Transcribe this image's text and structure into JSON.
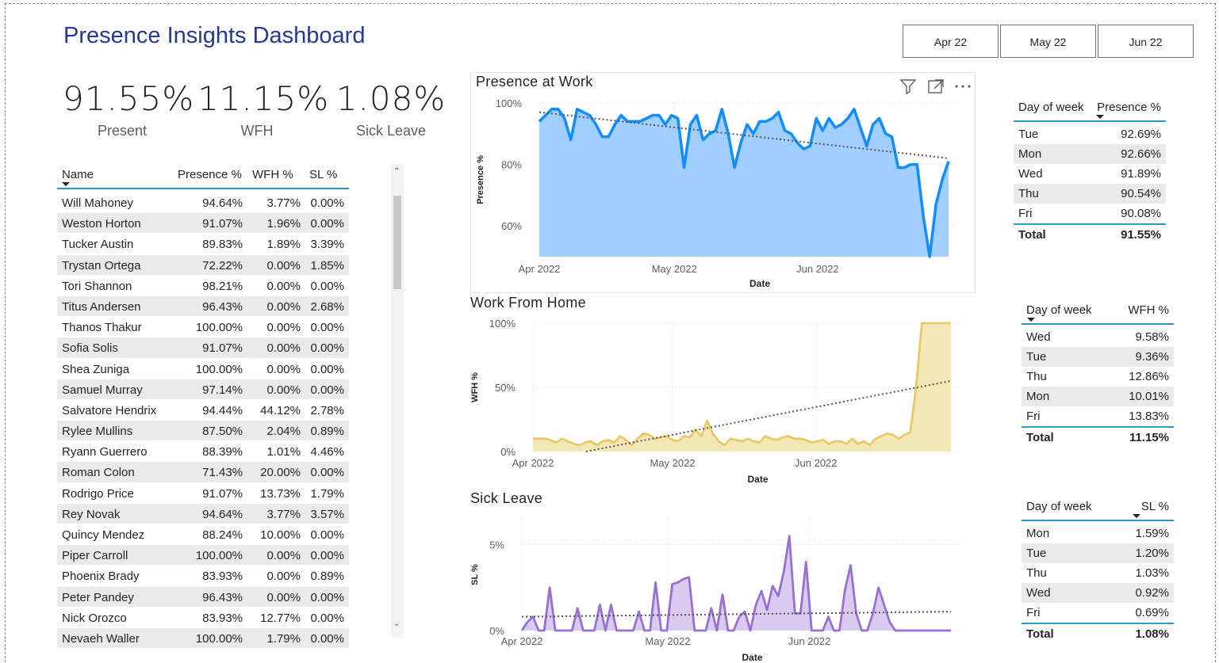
{
  "page": {
    "title": "Presence Insights Dashboard"
  },
  "month_buttons": [
    "Apr 22",
    "May 22",
    "Jun 22"
  ],
  "kpis": [
    {
      "value": "91.55%",
      "label": "Present"
    },
    {
      "value": "11.15%",
      "label": "WFH"
    },
    {
      "value": "1.08%",
      "label": "Sick Leave"
    }
  ],
  "name_table": {
    "headers": {
      "name": "Name",
      "presence": "Presence %",
      "wfh": "WFH %",
      "sl": "SL %"
    },
    "rows": [
      {
        "name": "Will Mahoney",
        "presence": "94.64%",
        "wfh": "3.77%",
        "sl": "0.00%"
      },
      {
        "name": "Weston Horton",
        "presence": "91.07%",
        "wfh": "1.96%",
        "sl": "0.00%"
      },
      {
        "name": "Tucker Austin",
        "presence": "89.83%",
        "wfh": "1.89%",
        "sl": "3.39%"
      },
      {
        "name": "Trystan Ortega",
        "presence": "72.22%",
        "wfh": "0.00%",
        "sl": "1.85%"
      },
      {
        "name": "Tori Shannon",
        "presence": "98.21%",
        "wfh": "0.00%",
        "sl": "0.00%"
      },
      {
        "name": "Titus Andersen",
        "presence": "96.43%",
        "wfh": "0.00%",
        "sl": "2.68%"
      },
      {
        "name": "Thanos Thakur",
        "presence": "100.00%",
        "wfh": "0.00%",
        "sl": "0.00%"
      },
      {
        "name": "Sofia Solis",
        "presence": "91.07%",
        "wfh": "0.00%",
        "sl": "0.00%"
      },
      {
        "name": "Shea Zuniga",
        "presence": "100.00%",
        "wfh": "0.00%",
        "sl": "0.00%"
      },
      {
        "name": "Samuel Murray",
        "presence": "97.14%",
        "wfh": "0.00%",
        "sl": "0.00%"
      },
      {
        "name": "Salvatore Hendrix",
        "presence": "94.44%",
        "wfh": "44.12%",
        "sl": "2.78%"
      },
      {
        "name": "Rylee Mullins",
        "presence": "87.50%",
        "wfh": "2.04%",
        "sl": "0.89%"
      },
      {
        "name": "Ryann Guerrero",
        "presence": "88.39%",
        "wfh": "1.01%",
        "sl": "4.46%"
      },
      {
        "name": "Roman Colon",
        "presence": "71.43%",
        "wfh": "20.00%",
        "sl": "0.00%"
      },
      {
        "name": "Rodrigo Price",
        "presence": "91.07%",
        "wfh": "13.73%",
        "sl": "1.79%"
      },
      {
        "name": "Rey Novak",
        "presence": "94.64%",
        "wfh": "3.77%",
        "sl": "3.57%"
      },
      {
        "name": "Quincy Mendez",
        "presence": "88.24%",
        "wfh": "10.00%",
        "sl": "0.00%"
      },
      {
        "name": "Piper Carroll",
        "presence": "100.00%",
        "wfh": "0.00%",
        "sl": "0.00%"
      },
      {
        "name": "Phoenix Brady",
        "presence": "83.93%",
        "wfh": "0.00%",
        "sl": "0.89%"
      },
      {
        "name": "Peter Pandey",
        "presence": "96.43%",
        "wfh": "0.00%",
        "sl": "0.00%"
      },
      {
        "name": "Nick Orozco",
        "presence": "83.93%",
        "wfh": "12.77%",
        "sl": "0.00%"
      },
      {
        "name": "Nevaeh Waller",
        "presence": "100.00%",
        "wfh": "1.79%",
        "sl": "0.00%"
      }
    ]
  },
  "day_tables": [
    {
      "headers": {
        "day": "Day of week",
        "metric": "Presence %"
      },
      "rows": [
        {
          "day": "Tue",
          "value": "92.69%"
        },
        {
          "day": "Mon",
          "value": "92.66%"
        },
        {
          "day": "Wed",
          "value": "91.89%"
        },
        {
          "day": "Thu",
          "value": "90.54%"
        },
        {
          "day": "Fri",
          "value": "90.08%"
        }
      ],
      "total": {
        "label": "Total",
        "value": "91.55%"
      }
    },
    {
      "headers": {
        "day": "Day of week",
        "metric": "WFH %"
      },
      "rows": [
        {
          "day": "Wed",
          "value": "9.58%"
        },
        {
          "day": "Tue",
          "value": "9.36%"
        },
        {
          "day": "Thu",
          "value": "12.86%"
        },
        {
          "day": "Mon",
          "value": "10.01%"
        },
        {
          "day": "Fri",
          "value": "13.83%"
        }
      ],
      "total": {
        "label": "Total",
        "value": "11.15%"
      }
    },
    {
      "headers": {
        "day": "Day of week",
        "metric": "SL %"
      },
      "rows": [
        {
          "day": "Mon",
          "value": "1.59%"
        },
        {
          "day": "Tue",
          "value": "1.20%"
        },
        {
          "day": "Thu",
          "value": "1.03%"
        },
        {
          "day": "Wed",
          "value": "0.92%"
        },
        {
          "day": "Fri",
          "value": "0.69%"
        }
      ],
      "total": {
        "label": "Total",
        "value": "1.08%"
      }
    }
  ],
  "icons": {
    "filter": "filter-icon",
    "focus": "focus-mode-icon",
    "more": "more-options-icon",
    "scroll_up": "chevron-up-icon",
    "scroll_down": "chevron-down-icon"
  },
  "colors": {
    "title": "#253896",
    "presence_line": "#118DFF",
    "presence_fill": "#A0CFFF",
    "wfh_line": "#E8C96A",
    "wfh_fill": "#F4E7B6",
    "sl_line": "#9A6FD2",
    "sl_fill": "#D9CBEF",
    "trend": "#555555",
    "table_accent": "#2F97C8"
  },
  "chart_data": [
    {
      "type": "area",
      "title": "Presence at Work",
      "xlabel": "Date",
      "ylabel": "Presence %",
      "x_ticks": [
        "Apr 2022",
        "May 2022",
        "Jun 2022"
      ],
      "y_ticks": [
        "60%",
        "80%",
        "100%"
      ],
      "xlim": [
        "2022-04-01",
        "2022-06-30"
      ],
      "ylim": [
        50,
        100
      ],
      "trendline": [
        97,
        82
      ],
      "values": [
        94,
        96,
        98,
        98,
        95,
        88,
        98,
        97,
        96,
        93,
        89,
        89,
        93,
        96,
        94,
        94,
        94,
        95,
        96,
        96,
        93,
        96,
        95,
        79,
        93,
        96,
        88,
        90,
        91,
        98,
        90,
        79,
        87,
        93,
        90,
        94,
        94,
        95,
        97,
        91,
        90,
        87,
        85,
        86,
        95,
        91,
        95,
        92,
        93,
        95,
        98,
        92,
        86,
        93,
        95,
        90,
        89,
        79,
        79,
        80,
        80,
        63,
        50,
        67,
        75,
        81
      ]
    },
    {
      "type": "area",
      "title": "Work From Home",
      "xlabel": "Date",
      "ylabel": "WFH %",
      "x_ticks": [
        "Apr 2022",
        "May 2022",
        "Jun 2022"
      ],
      "y_ticks": [
        "0%",
        "50%",
        "100%"
      ],
      "xlim": [
        "2022-04-01",
        "2022-06-30"
      ],
      "ylim": [
        0,
        100
      ],
      "trendline": [
        -8,
        55
      ],
      "values": [
        10,
        10,
        10,
        9,
        7,
        10,
        8,
        6,
        5,
        7,
        8,
        5,
        8,
        9,
        7,
        12,
        9,
        5,
        10,
        14,
        13,
        10,
        11,
        12,
        9,
        8,
        12,
        11,
        17,
        12,
        24,
        14,
        8,
        5,
        10,
        9,
        8,
        10,
        8,
        7,
        12,
        10,
        9,
        11,
        12,
        10,
        10,
        9,
        7,
        8,
        9,
        6,
        8,
        8,
        6,
        10,
        6,
        8,
        5,
        10,
        12,
        14,
        13,
        10,
        13,
        15,
        50,
        100,
        100,
        100,
        100,
        100,
        100
      ]
    },
    {
      "type": "area",
      "title": "Sick Leave",
      "xlabel": "Date",
      "ylabel": "SL %",
      "x_ticks": [
        "Apr 2022",
        "May 2022",
        "Jun 2022"
      ],
      "y_ticks": [
        "0%",
        "5%"
      ],
      "xlim": [
        "2022-04-01",
        "2022-06-30"
      ],
      "ylim": [
        0,
        6.5
      ],
      "trendline": [
        0.8,
        1.1
      ],
      "values": [
        0,
        0.5,
        0.8,
        0,
        0,
        2.5,
        0,
        0,
        0,
        0,
        1.3,
        0,
        0,
        0,
        1.5,
        0,
        1.5,
        0,
        0,
        0,
        0,
        1.1,
        0,
        0,
        2.8,
        0,
        0,
        2.7,
        2.8,
        3.0,
        3.1,
        0,
        0,
        0,
        1.3,
        0,
        2.1,
        0,
        0,
        0.8,
        1.1,
        0,
        1.5,
        2.3,
        1.2,
        2.6,
        2.0,
        3.4,
        5.5,
        1.0,
        1.0,
        4.0,
        0,
        0,
        0,
        0.8,
        0,
        0,
        2.4,
        3.8,
        1.0,
        0,
        0,
        1.0,
        2.5,
        1.5,
        0.5,
        0,
        0,
        0,
        0,
        0,
        0,
        0,
        0,
        0,
        0,
        0
      ]
    }
  ]
}
